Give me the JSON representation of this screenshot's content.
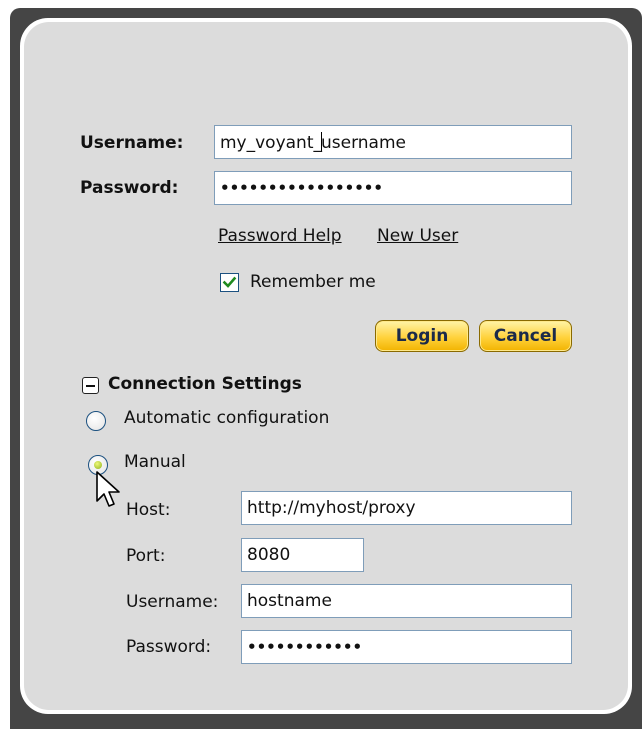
{
  "login": {
    "username_label": "Username:",
    "username_value": "my_voyant_",
    "username_value_after_caret": "username",
    "password_label": "Password:",
    "password_mask": "•••••••••••••••••",
    "password_help_link": "Password Help",
    "new_user_link": "New User",
    "remember_me_label": "Remember me",
    "remember_me_checked": true,
    "login_button": "Login",
    "cancel_button": "Cancel"
  },
  "connection": {
    "section_title": "Connection Settings",
    "automatic_label": "Automatic configuration",
    "manual_label": "Manual",
    "selected": "Manual",
    "host_label": "Host:",
    "host_value": "http://myhost/proxy",
    "port_label": "Port:",
    "port_value": "8080",
    "username_label": "Username:",
    "username_value": "hostname",
    "password_label": "Password:",
    "password_mask": "••••••••••••"
  },
  "colors": {
    "button_gold": "#ffd23c",
    "checkbox_green": "#1f8a1f",
    "radio_selected": "#b3cf2a"
  }
}
